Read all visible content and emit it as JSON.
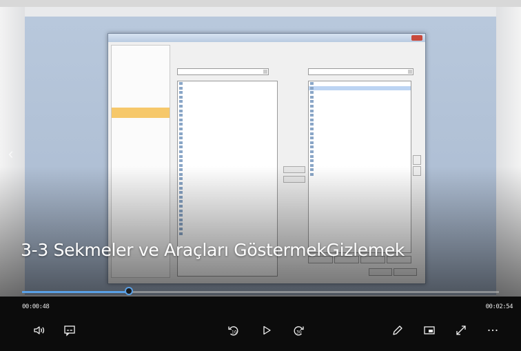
{
  "video": {
    "title": "3-3 Sekmeler ve Araçları GöstermekGizlemek",
    "progress": 0.224
  },
  "player": {
    "current_time": "00:00:48",
    "total_time": "00:02:54",
    "progress_color": "#5aa0e6",
    "icons": {
      "volume": "volume-icon",
      "captions": "captions-icon",
      "skip_back": "skip-back-10-icon",
      "play": "play-icon",
      "skip_forward": "skip-forward-30-icon",
      "edit": "pencil-icon",
      "mini_view": "mini-view-icon",
      "fullscreen": "fullscreen-icon",
      "more": "more-options-icon"
    }
  }
}
